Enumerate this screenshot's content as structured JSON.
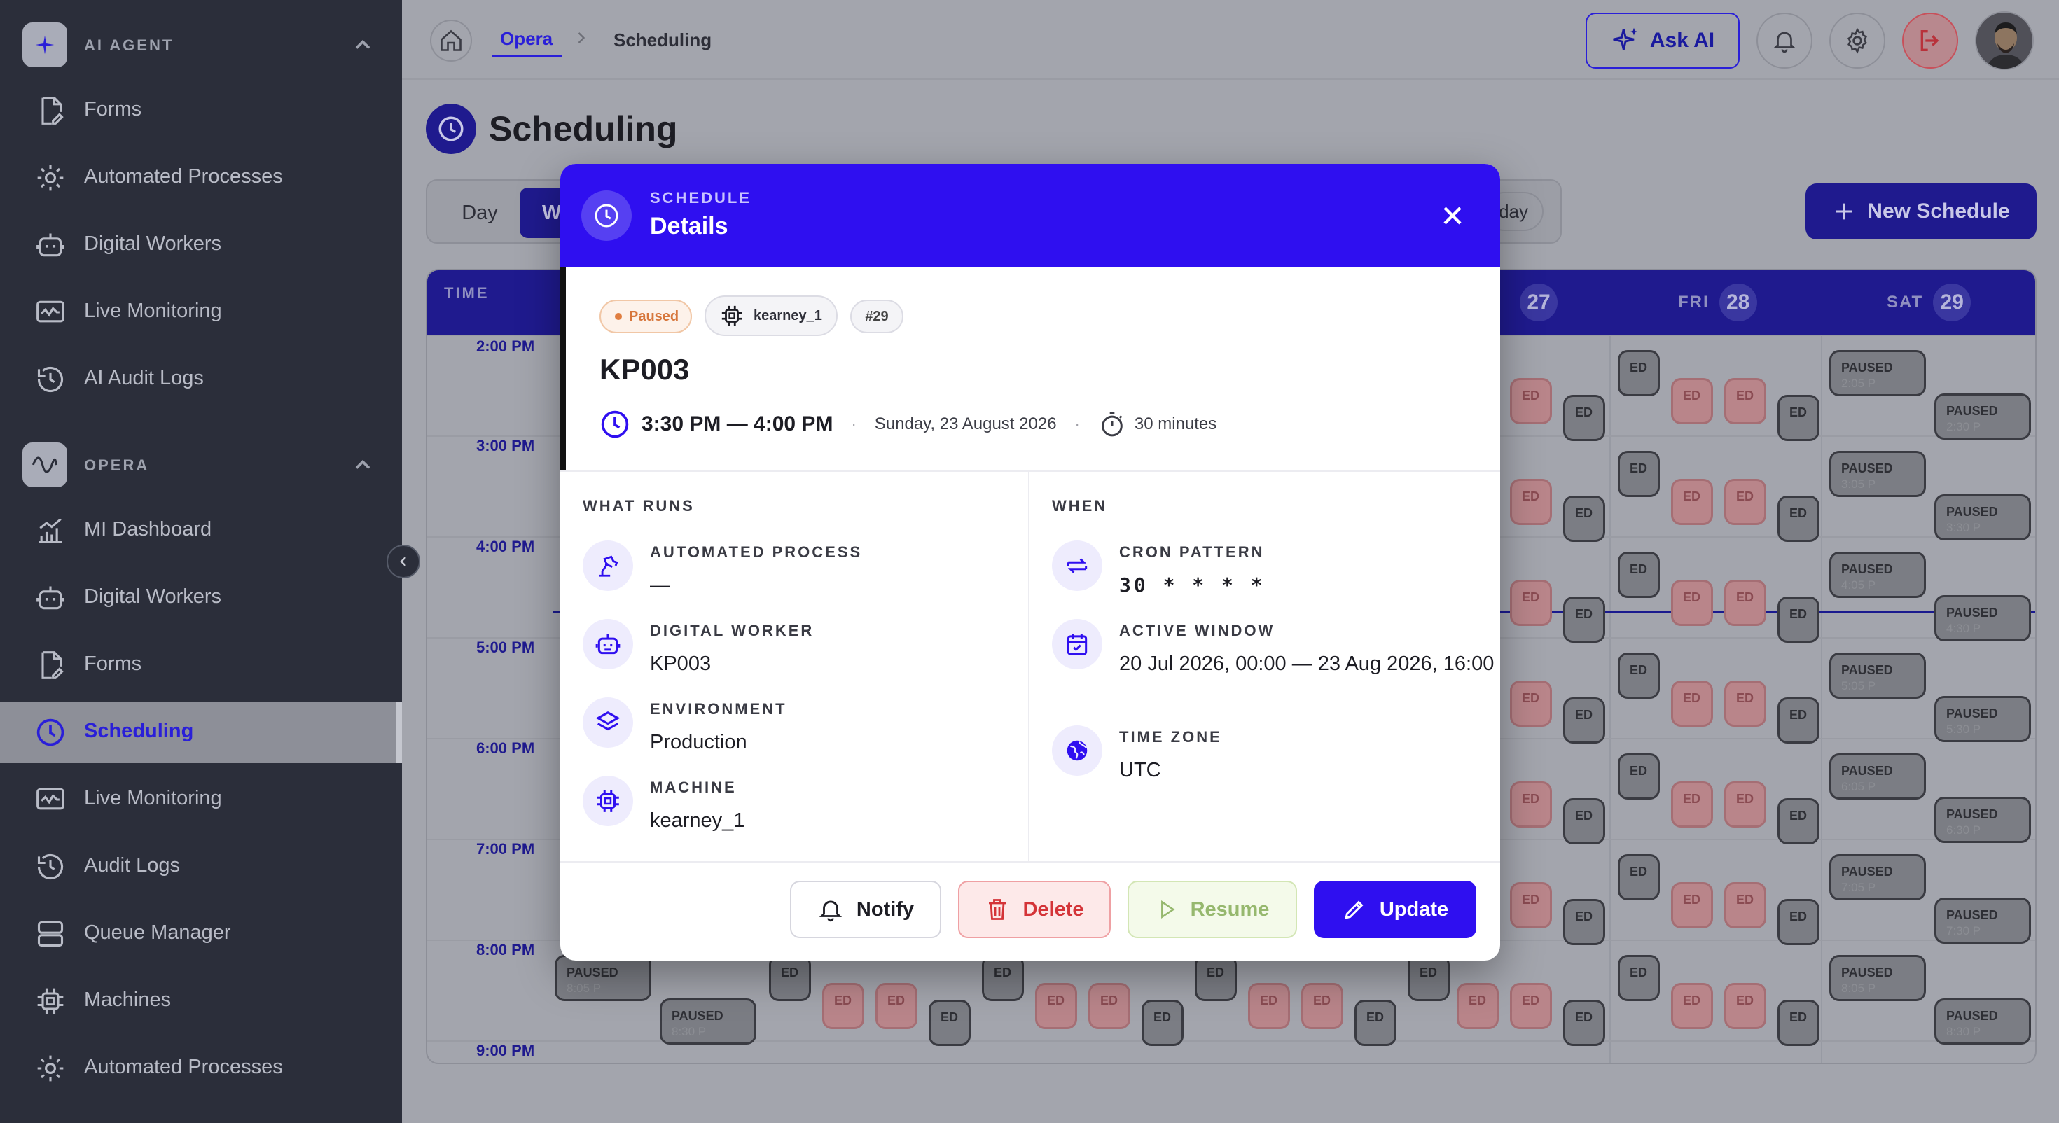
{
  "sidebar": {
    "sections": [
      {
        "label": "AI AGENT",
        "items": [
          "Forms",
          "Automated Processes",
          "Digital Workers",
          "Live Monitoring",
          "AI Audit Logs"
        ]
      },
      {
        "label": "OPERA",
        "items": [
          "MI Dashboard",
          "Digital Workers",
          "Forms",
          "Scheduling",
          "Live Monitoring",
          "Audit Logs",
          "Queue Manager",
          "Machines",
          "Automated Processes"
        ]
      }
    ],
    "active_item": "Scheduling"
  },
  "topbar": {
    "breadcrumb": [
      "Opera",
      "Scheduling"
    ],
    "ask_ai_label": "Ask AI"
  },
  "page": {
    "title": "Scheduling",
    "view_tabs": [
      "Day",
      "W"
    ],
    "today_label": "day",
    "new_schedule_label": "New Schedule"
  },
  "calendar": {
    "time_header": "TIME",
    "days": [
      {
        "name": "",
        "num": "27"
      },
      {
        "name": "FRI",
        "num": "28"
      },
      {
        "name": "SAT",
        "num": "29"
      }
    ],
    "hours": [
      "2:00 PM",
      "3:00 PM",
      "4:00 PM",
      "5:00 PM",
      "6:00 PM",
      "7:00 PM",
      "8:00 PM",
      "9:00 PM"
    ],
    "chip_text": "PAUSED",
    "chip_partial": "ED",
    "chip_times_sat_a": [
      "2:05 P",
      "3:05 P",
      "4:05 P",
      "5:05 P",
      "6:05 P",
      "7:05 P",
      "8:05 P"
    ],
    "chip_times_sat_b": [
      "2:30 P",
      "3:30 P",
      "4:30 P",
      "5:30 P",
      "6:30 P",
      "7:30 P",
      "8:30 P"
    ],
    "chip_times_first": [
      "8:05 P",
      "8:30 P"
    ],
    "sat_top_partial": "1:30 P"
  },
  "modal": {
    "kicker": "SCHEDULE",
    "title": "Details",
    "status_badge": "Paused",
    "machine_badge": "kearney_1",
    "id_badge": "#29",
    "job_name": "KP003",
    "time_range": "3:30 PM — 4:00 PM",
    "date": "Sunday, 23 August 2026",
    "duration": "30 minutes",
    "what_runs": {
      "title": "WHAT RUNS",
      "fields": [
        {
          "label": "AUTOMATED PROCESS",
          "value": "—",
          "icon": "robot-arm-icon"
        },
        {
          "label": "DIGITAL WORKER",
          "value": "KP003",
          "icon": "bot-icon"
        },
        {
          "label": "ENVIRONMENT",
          "value": "Production",
          "icon": "layers-icon"
        },
        {
          "label": "MACHINE",
          "value": "kearney_1",
          "icon": "cpu-icon"
        }
      ]
    },
    "when": {
      "title": "WHEN",
      "fields": [
        {
          "label": "CRON PATTERN",
          "value": "30 * * * *",
          "icon": "repeat-icon"
        },
        {
          "label": "ACTIVE WINDOW",
          "value": "20 Jul 2026, 00:00 — 23 Aug 2026, 16:00",
          "icon": "calendar-check-icon"
        },
        {
          "label": "TIME ZONE",
          "value": "UTC",
          "icon": "globe-icon"
        }
      ]
    },
    "buttons": {
      "notify": "Notify",
      "delete": "Delete",
      "resume": "Resume",
      "update": "Update"
    }
  },
  "colors": {
    "brand": "#2f0ff0",
    "sidebar_bg": "#2b2e3a",
    "paused_orange": "#d7773c",
    "delete_red": "#d43438",
    "resume_green": "#96b86e"
  }
}
